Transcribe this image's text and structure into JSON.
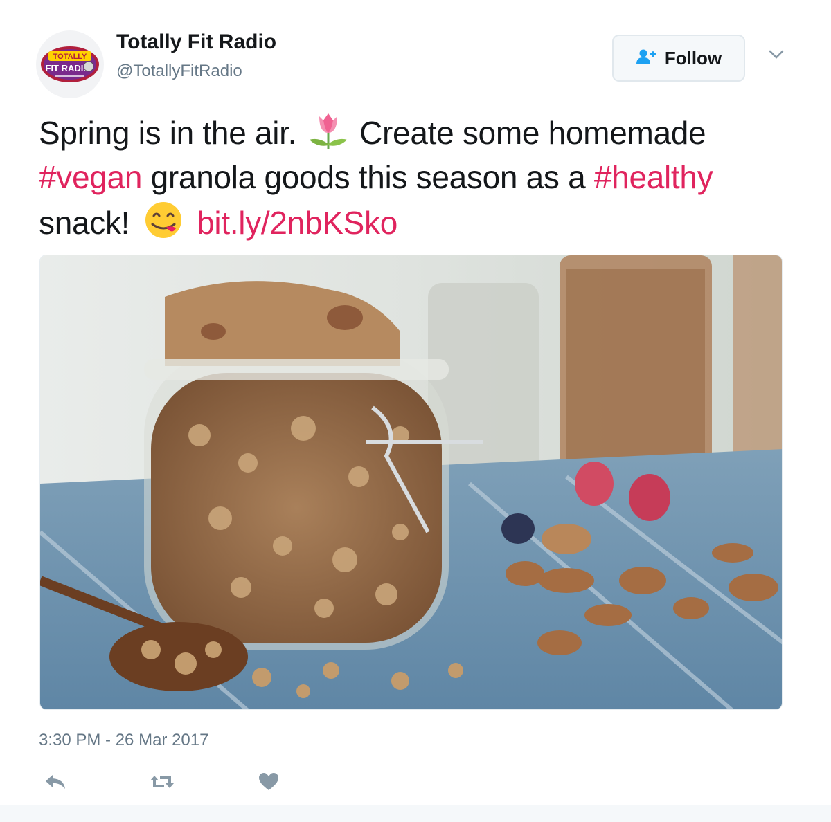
{
  "author": {
    "name": "Totally Fit Radio",
    "handle": "@TotallyFitRadio",
    "avatar_logo_text": "TOTALLY FIT RADIO"
  },
  "follow_button": {
    "label": "Follow",
    "icon": "add-user-icon"
  },
  "more_menu": {
    "icon": "chevron-down-icon"
  },
  "tweet": {
    "line1_a": "Spring is in the air.",
    "line1_emoji": "tulip",
    "line1_b": "Create some homemade",
    "hashtag_vegan": "#vegan",
    "line2_mid": "granola goods this season as a",
    "hashtag_healthy": "#healthy",
    "line3_a": "snack!",
    "line3_emoji": "face-savoring-food",
    "link": "bit.ly/2nbKSko"
  },
  "media": {
    "description_icon": "granola-jar-photo"
  },
  "timestamp": "3:30 PM - 26 Mar 2017",
  "actions": [
    {
      "name": "reply",
      "icon": "reply-icon"
    },
    {
      "name": "retweet",
      "icon": "retweet-icon"
    },
    {
      "name": "like",
      "icon": "heart-icon"
    }
  ],
  "colors": {
    "hashtag": "#e0245e",
    "secondary_text": "#657786",
    "primary_text": "#14171a",
    "icon_gray": "#8899a6",
    "follow_icon": "#1da1f2"
  }
}
